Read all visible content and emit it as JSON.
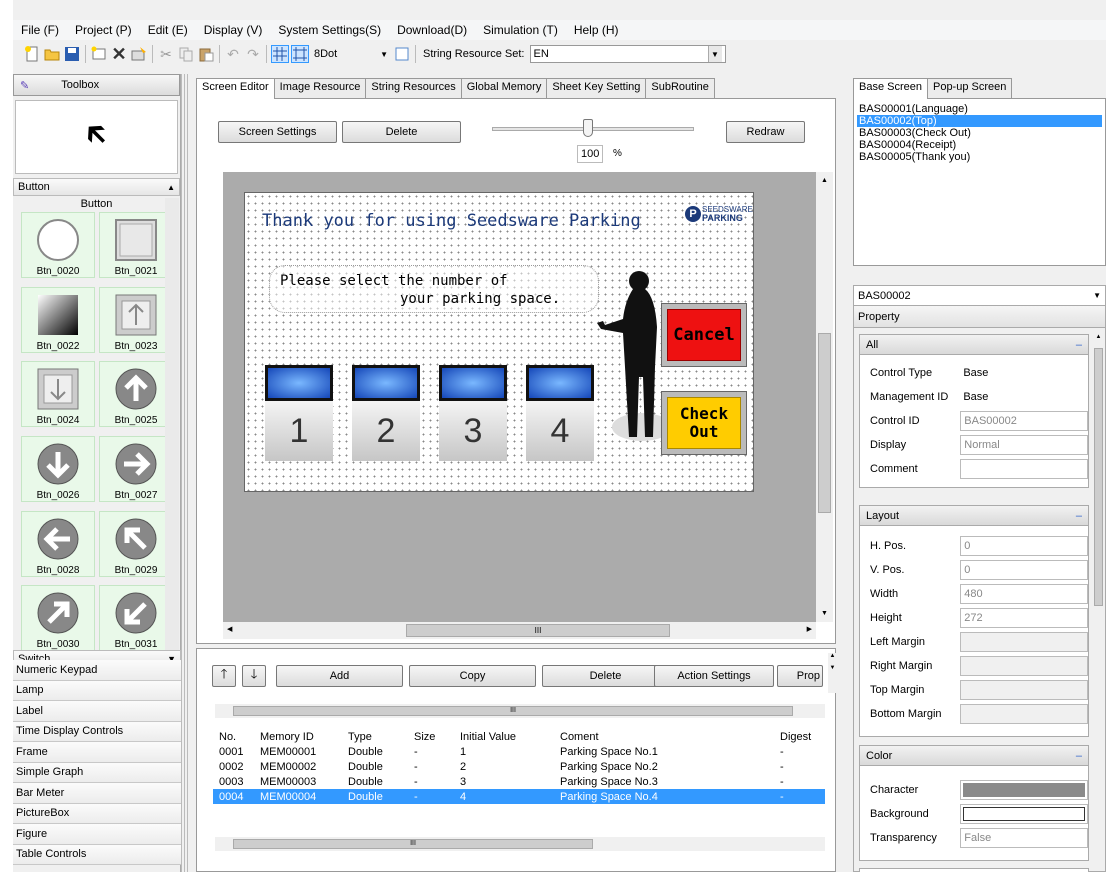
{
  "menu": [
    "File (F)",
    "Project (P)",
    "Edit (E)",
    "Display (V)",
    "System Settings(S)",
    "Download(D)",
    "Simulation (T)",
    "Help (H)"
  ],
  "toolbar": {
    "dot": "8Dot",
    "string_resource_label": "String Resource Set:",
    "string_resource_value": "EN"
  },
  "toolbox": {
    "title": "Toolbox",
    "section_button": "Button",
    "group_label": "Button",
    "buttons": [
      "Btn_0020",
      "Btn_0021",
      "Btn_0022",
      "Btn_0023",
      "Btn_0024",
      "Btn_0025",
      "Btn_0026",
      "Btn_0027",
      "Btn_0028",
      "Btn_0029",
      "Btn_0030",
      "Btn_0031"
    ],
    "section_switch": "Switch",
    "categories": [
      "Numeric Keypad",
      "Lamp",
      "Label",
      "Time Display Controls",
      "Frame",
      "Simple Graph",
      "Bar Meter",
      "PictureBox",
      "Figure",
      "Table Controls"
    ]
  },
  "tabs": [
    "Screen Editor",
    "Image Resource",
    "String Resources",
    "Global Memory",
    "Sheet Key Setting",
    "SubRoutine"
  ],
  "editor": {
    "screen_settings": "Screen Settings",
    "delete": "Delete",
    "redraw": "Redraw",
    "zoom": "100",
    "zoom_unit": "%",
    "canvas": {
      "title": "Thank you for using Seedsware Parking",
      "logo_top": "SEEDSWARE",
      "logo_bottom": "PARKING",
      "prompt_line1": "Please select the number of",
      "prompt_line2": "your parking space.",
      "cancel": "Cancel",
      "checkout_line1": "Check",
      "checkout_line2": "Out",
      "spaces": [
        "1",
        "2",
        "3",
        "4"
      ]
    },
    "hscroll_mark": "III"
  },
  "memory": {
    "add": "Add",
    "copy": "Copy",
    "delete": "Delete",
    "action_settings": "Action Settings",
    "prop": "Prop",
    "columns": [
      "No.",
      "Memory ID",
      "Type",
      "Size",
      "Initial Value",
      "Coment",
      "Digest"
    ],
    "rows": [
      [
        "0001",
        "MEM00001",
        "Double",
        "-",
        "1",
        "Parking Space No.1",
        "-"
      ],
      [
        "0002",
        "MEM00002",
        "Double",
        "-",
        "2",
        "Parking Space No.2",
        "-"
      ],
      [
        "0003",
        "MEM00003",
        "Double",
        "-",
        "3",
        "Parking Space No.3",
        "-"
      ],
      [
        "0004",
        "MEM00004",
        "Double",
        "-",
        "4",
        "Parking Space No.4",
        "-"
      ]
    ],
    "selected_row": 3
  },
  "screens": {
    "tabs": [
      "Base Screen",
      "Pop-up Screen"
    ],
    "items": [
      "BAS00001(Language)",
      "BAS00002(Top)",
      "BAS00003(Check Out)",
      "BAS00004(Receipt)",
      "BAS00005(Thank you)"
    ],
    "selected": 1
  },
  "properties": {
    "selector": "BAS00002",
    "title": "Property",
    "all": {
      "header": "All",
      "rows": [
        [
          "Control Type",
          "Base"
        ],
        [
          "Management ID",
          "Base"
        ],
        [
          "Control ID",
          "BAS00002"
        ],
        [
          "Display",
          "Normal"
        ],
        [
          "Comment",
          ""
        ]
      ]
    },
    "layout": {
      "header": "Layout",
      "rows": [
        [
          "H. Pos.",
          "0"
        ],
        [
          "V. Pos.",
          "0"
        ],
        [
          "Width",
          "480"
        ],
        [
          "Height",
          "272"
        ],
        [
          "Left Margin",
          ""
        ],
        [
          "Right Margin",
          ""
        ],
        [
          "Top Margin",
          ""
        ],
        [
          "Bottom Margin",
          ""
        ]
      ]
    },
    "color": {
      "header": "Color",
      "character": "Character",
      "background": "Background",
      "transparency": "Transparency",
      "transparency_value": "False"
    },
    "collapse": "–"
  },
  "colors": {
    "selection": "#3399ff",
    "cancel": "#ee1111",
    "checkout": "#ffcc00"
  }
}
